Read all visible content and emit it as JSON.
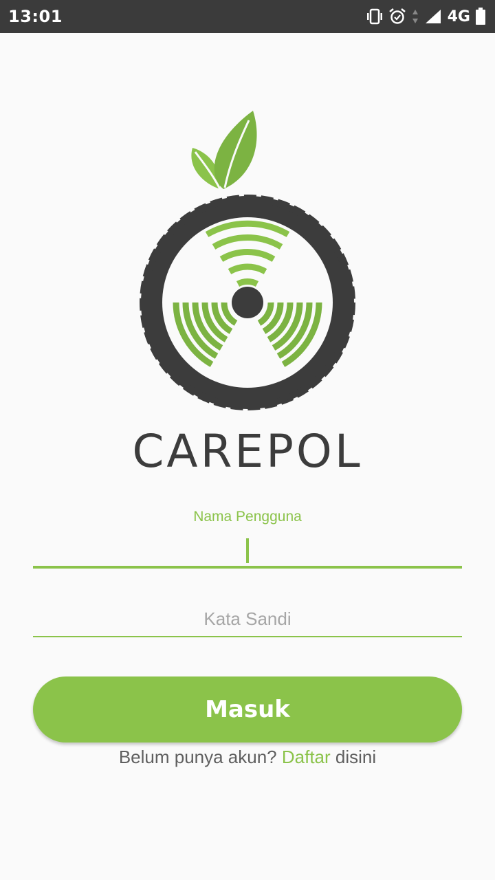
{
  "status_bar": {
    "time": "13:01",
    "network": "4G",
    "icons": [
      "vibrate-icon",
      "alarm-icon",
      "data-arrows-icon",
      "signal-icon",
      "battery-icon"
    ]
  },
  "logo": {
    "colors": {
      "leaf": "#7cb342",
      "tire": "#3c3c3c",
      "waves": "#8bc34a"
    }
  },
  "brand": {
    "name": "CAREPOL"
  },
  "login_form": {
    "username_label": "Nama Pengguna",
    "username_value": "",
    "password_placeholder": "Kata Sandi",
    "password_value": "",
    "submit_label": "Masuk"
  },
  "signup": {
    "prefix": "Belum punya akun?",
    "link": "Daftar",
    "suffix": "disini"
  },
  "colors": {
    "accent": "#8bc34a",
    "status_bar": "#3b3b3b",
    "background": "#fafafa"
  }
}
